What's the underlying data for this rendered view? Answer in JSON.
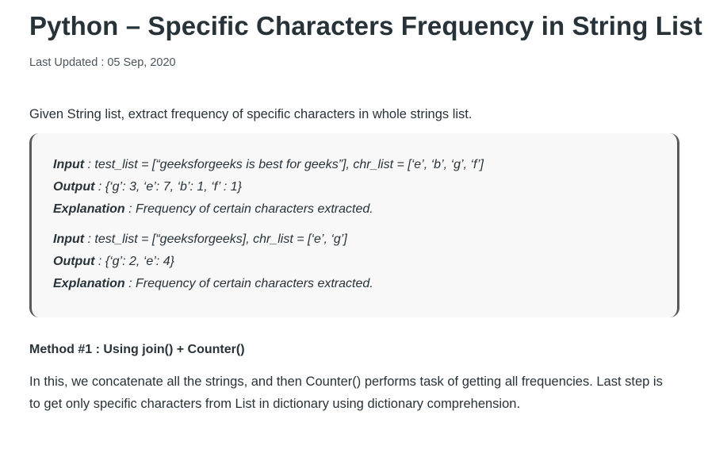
{
  "article": {
    "title": "Python – Specific Characters Frequency in String List",
    "last_updated": "Last Updated : 05 Sep, 2020",
    "intro": "Given String list, extract frequency of specific characters in whole strings list."
  },
  "examples": [
    {
      "input_label": "Input",
      "input_text": " : test_list = [“geeksforgeeks is best for geeks”], chr_list = [‘e’, ‘b’, ‘g’, ‘f’]",
      "output_label": "Output",
      "output_text": " : {‘g’: 3, ‘e’: 7, ‘b’: 1, ‘f’ : 1}",
      "explanation_label": "Explanation",
      "explanation_text": " : Frequency of certain characters extracted."
    },
    {
      "input_label": "Input",
      "input_text": " : test_list = [“geeksforgeeks], chr_list = [‘e’, ‘g’]",
      "output_label": "Output",
      "output_text": " : {‘g’: 2, ‘e’: 4}",
      "explanation_label": "Explanation",
      "explanation_text": " : Frequency of certain characters extracted."
    }
  ],
  "method": {
    "heading": "Method #1 : Using join() + Counter()",
    "description": "In this, we concatenate all the strings, and then Counter() performs task of getting all frequencies. Last step is to get only specific characters from List in dictionary using dictionary comprehension."
  }
}
